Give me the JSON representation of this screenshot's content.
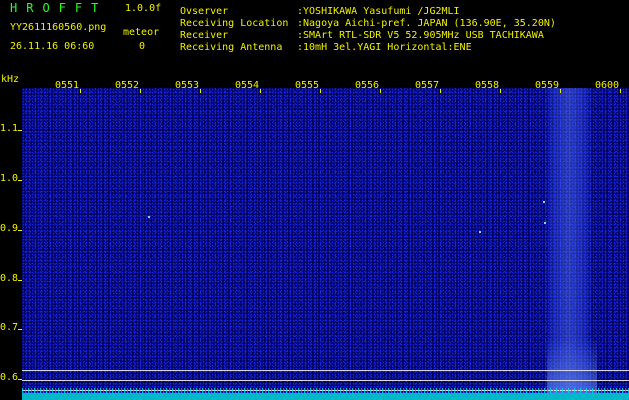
{
  "app": {
    "title": "HROFFT",
    "version": "1.0.0f"
  },
  "file": {
    "name": "YY2611160560.png",
    "datetime": "26.11.16 06:60"
  },
  "meteor": {
    "label": "meteor",
    "count": "0"
  },
  "header": [
    {
      "label": "Ovserver",
      "value": ":YOSHIKAWA Yasufumi /JG2MLI"
    },
    {
      "label": "Receiving Location",
      "value": ":Nagoya Aichi-pref. JAPAN (136.90E, 35.20N)"
    },
    {
      "label": "Receiver",
      "value": ":SMArt RTL-SDR V5 52.905MHz USB TACHIKAWA"
    },
    {
      "label": "Receiving Antenna",
      "value": ":10mH 3el.YAGI Horizontal:ENE"
    }
  ],
  "axis": {
    "y_unit": "kHz",
    "y_ticks": [
      "1.1",
      "1.0",
      "0.9",
      "0.8",
      "0.7",
      "0.6"
    ],
    "x_ticks": [
      "0551",
      "0552",
      "0553",
      "0554",
      "0555",
      "0556",
      "0557",
      "0558",
      "0559",
      "0600"
    ]
  },
  "colors": {
    "label": "#f2f200",
    "title": "#22ff22",
    "background": "#000060",
    "spectrum_floor": "#00b8c8"
  }
}
